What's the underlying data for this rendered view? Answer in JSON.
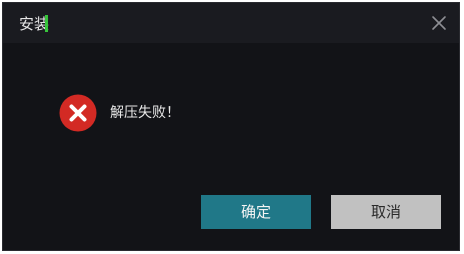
{
  "window": {
    "title": "安装",
    "close_icon": "close-icon"
  },
  "dialog": {
    "icon": "error-circle-icon",
    "message": "解压失败！"
  },
  "buttons": {
    "ok_label": "确定",
    "cancel_label": "取消"
  },
  "colors": {
    "title_bar": "#1a1b20",
    "background": "#121317",
    "error_red": "#d32a24",
    "ok_button": "#207888",
    "cancel_button": "#c1c1c1",
    "cursor_green": "#37c43b"
  }
}
